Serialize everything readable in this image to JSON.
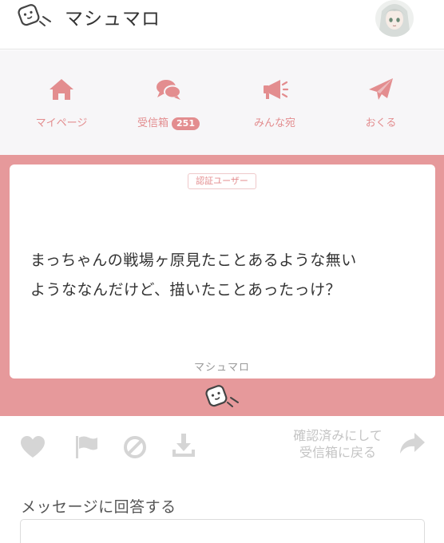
{
  "header": {
    "title": "マシュマロ"
  },
  "nav": {
    "items": [
      {
        "label": "マイページ",
        "icon": "home-icon"
      },
      {
        "label": "受信箱",
        "badge": "251",
        "icon": "chat-bubbles-icon"
      },
      {
        "label": "みんな宛",
        "icon": "megaphone-icon"
      },
      {
        "label": "おくる",
        "icon": "paper-plane-icon"
      }
    ]
  },
  "card": {
    "verified_label": "認証ユーザー",
    "message_line1": "まっちゃんの戦場ヶ原見たことあるような無い",
    "message_line2": "ようななんだけど、描いたことあったっけ？",
    "brand": "マシュマロ"
  },
  "actions": {
    "archive_line1": "確認済みにして",
    "archive_line2": "受信箱に戻る"
  },
  "answer": {
    "title": "メッセージに回答する"
  },
  "colors": {
    "accent": "#e38d8f",
    "card_band": "#e6999b",
    "nav_bg": "#f7f6f8",
    "muted_icon": "#d5d5d5"
  }
}
